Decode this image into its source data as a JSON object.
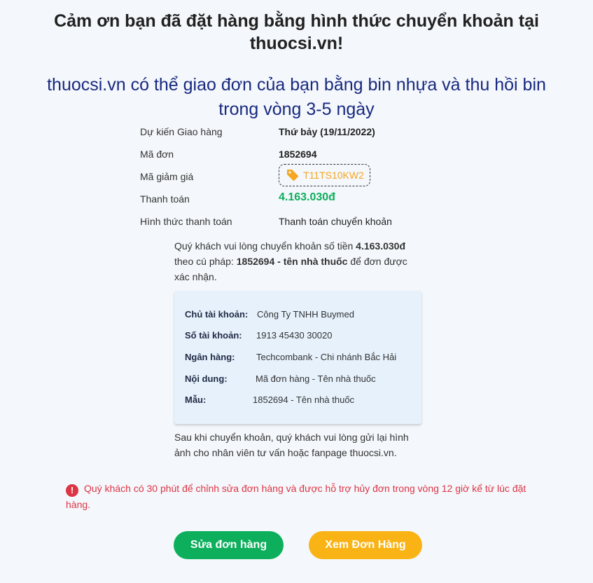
{
  "header": {
    "title": "Cảm ơn bạn đã đặt hàng bằng hình thức chuyển khoản tại thuocsi.vn!",
    "subtitle": "thuocsi.vn có thể giao đơn của bạn bằng bin nhựa và thu hồi bin trong vòng 3-5 ngày"
  },
  "order": {
    "delivery_label": "Dự kiến Giao hàng",
    "delivery_value": "Thứ bảy (19/11/2022)",
    "order_id_label": "Mã đơn",
    "order_id_value": "1852694",
    "coupon_label": "Mã giảm giá",
    "coupon_code": "T11TS10KW2",
    "payment_label": "Thanh toán",
    "payment_value": "4.163.030đ",
    "method_label": "Hình thức thanh toán",
    "method_value": "Thanh toán chuyển khoản"
  },
  "instructions": {
    "part1": "Quý khách vui lòng chuyển khoản số tiền ",
    "amount": "4.163.030đ",
    "part2": " theo cú pháp: ",
    "syntax": "1852694 - tên nhà thuốc",
    "part3": " để đơn được xác nhận."
  },
  "bank": {
    "holder_label": "Chủ tài khoản:",
    "holder_value": "Công Ty TNHH Buymed",
    "account_label": "Số tài khoản:",
    "account_value": "1913 45430 30020",
    "bank_label": "Ngân hàng:",
    "bank_value": "Techcombank - Chi nhánh Bắc Hải",
    "content_label": "Nội dung:",
    "content_value": "Mã đơn hàng - Tên nhà thuốc",
    "sample_label": "Mẫu:",
    "sample_value": "1852694 - Tên nhà thuốc"
  },
  "after_text": "Sau khi chuyển khoản, quý khách vui lòng gửi lại hình ảnh cho nhân viên tư vấn hoặc fanpage thuocsi.vn.",
  "warning": {
    "icon": "!",
    "text": "Quý khách có 30 phút để chỉnh sửa đơn hàng và được hỗ trợ hủy đơn trong vòng 12 giờ kể từ lúc đặt hàng."
  },
  "buttons": {
    "edit_label": "Sửa đơn hàng",
    "view_label": "Xem Đơn Hàng"
  },
  "colors": {
    "green": "#0daf5c",
    "orange": "#f9b315",
    "navy": "#182980",
    "danger": "#dc3545"
  }
}
